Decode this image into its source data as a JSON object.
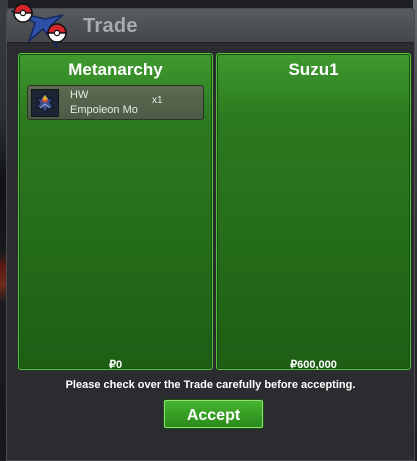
{
  "window": {
    "title": "Trade",
    "notice": "Please check over the Trade carefully before accepting.",
    "accept_label": "Accept"
  },
  "panels": [
    {
      "player": "Metanarchy",
      "money_symbol": "₽",
      "money": "0",
      "items": [
        {
          "line1": "HW",
          "line2": "Empoleon Mo",
          "qty": "x1",
          "icon": "empoleon-sprite-icon"
        }
      ]
    },
    {
      "player": "Suzu1",
      "money_symbol": "₽",
      "money": "600,000",
      "items": []
    }
  ],
  "colors": {
    "panel_green": "#2c7a1f",
    "panel_border": "#53c43a",
    "accept_green": "#3aa526",
    "titlebar": "#4f5256"
  }
}
